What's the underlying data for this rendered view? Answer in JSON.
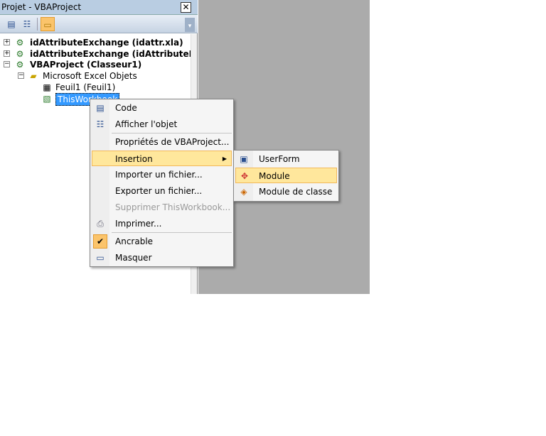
{
  "pane": {
    "title": "Projet - VBAProject",
    "close": "✕"
  },
  "toolbar": {
    "view_code": "▤",
    "view_object": "☷",
    "toggle_folders": "▭",
    "more": "▾"
  },
  "tree": [
    {
      "label": "idAttributeExchange (idattr.xla)",
      "expander": "+"
    },
    {
      "label": "idAttributeExchange (idAttributeExchange",
      "expander": "+"
    },
    {
      "label": "VBAProject (Classeur1)",
      "expander": "−"
    },
    {
      "label": "Microsoft Excel Objets",
      "expander": "−"
    },
    {
      "label": "Feuil1 (Feuil1)"
    },
    {
      "label": "ThisWorkbook"
    }
  ],
  "context_menu": {
    "items": [
      {
        "label": "Code",
        "icon": "code-window-icon"
      },
      {
        "label": "Afficher l'objet",
        "icon": "object-icon"
      },
      {
        "label": "Propriétés de VBAProject..."
      },
      {
        "label": "Insertion",
        "highlighted": true,
        "submenu_arrow": "▶"
      },
      {
        "label": "Importer un fichier..."
      },
      {
        "label": "Exporter un fichier..."
      },
      {
        "label": "Supprimer ThisWorkbook...",
        "disabled": true
      },
      {
        "label": "Imprimer...",
        "icon": "printer-icon"
      },
      {
        "label": "Ancrable",
        "checked": true,
        "check": "✔"
      },
      {
        "label": "Masquer",
        "icon": "hide-window-icon"
      }
    ]
  },
  "submenu": {
    "items": [
      {
        "label": "UserForm",
        "icon": "userform-icon"
      },
      {
        "label": "Module",
        "icon": "module-icon",
        "highlighted": true
      },
      {
        "label": "Module de classe",
        "icon": "class-module-icon"
      }
    ]
  },
  "colors": {
    "highlight": "#ffe79c",
    "highlight_border": "#f2b85a",
    "workspace": "#ababab",
    "selection": "#3399ff"
  }
}
